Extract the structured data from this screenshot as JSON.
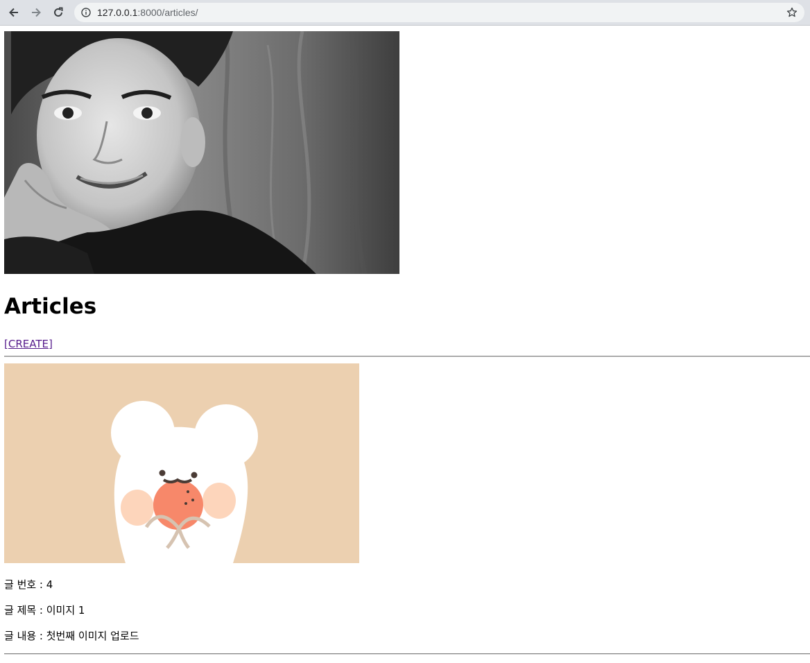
{
  "browser": {
    "url_host": "127.0.0.1",
    "url_path": ":8000/articles/",
    "back_icon": "arrow-left-icon",
    "forward_icon": "arrow-right-icon",
    "reload_icon": "reload-icon",
    "info_icon": "info-icon",
    "bookmark_icon": "star-icon"
  },
  "page": {
    "heading": "Articles",
    "create_link": "[CREATE]"
  },
  "articles": [
    {
      "number_line": "글 번호 : 4",
      "title_line": "글 제목 : 이미지 1",
      "content_line": "글 내용 : 첫번째 이미지 업로드"
    }
  ]
}
